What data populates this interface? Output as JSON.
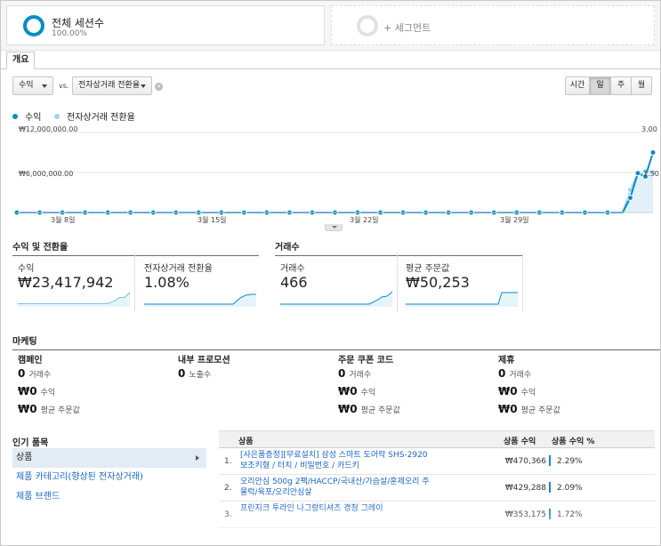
{
  "segments": {
    "active_title": "전체 세션수",
    "active_percent": "100.00%",
    "add_label": "+ 세그먼트"
  },
  "tab": {
    "label": "개요"
  },
  "controls": {
    "metric1": "수익",
    "vs": "vs.",
    "metric2": "전자상거래 전환율",
    "granularity": [
      "시간",
      "일",
      "주",
      "월"
    ],
    "active_granularity": "일"
  },
  "legend": [
    {
      "label": "수익",
      "color": "#058dc7"
    },
    {
      "label": "전자상거래 전환율",
      "color": "#9fd4ee"
    }
  ],
  "chart_data": {
    "type": "line",
    "y_left_ticks": [
      "₩12,000,000.00",
      "₩6,000,000.00"
    ],
    "y_right_ticks": [
      "3.00",
      "1.50"
    ],
    "x_tick_labels": [
      "3월 8일",
      "3월 15일",
      "3월 22일",
      "3월 29일"
    ],
    "ylim_left": [
      0,
      12000000
    ],
    "ylim_right": [
      0,
      3.0
    ],
    "series": [
      {
        "name": "수익",
        "values": [
          0,
          0,
          0,
          0,
          0,
          0,
          0,
          0,
          0,
          0,
          0,
          0,
          0,
          0,
          0,
          0,
          0,
          0,
          0,
          0,
          0,
          0,
          0,
          0,
          0,
          0,
          0,
          0,
          0,
          0,
          0,
          0,
          0,
          0,
          0,
          0,
          0,
          0,
          0,
          0,
          0,
          0,
          0,
          0,
          0,
          0,
          0,
          0,
          0,
          0,
          0,
          0,
          0,
          0,
          0,
          0,
          0,
          0,
          0,
          0,
          0,
          0,
          0,
          0,
          0,
          0,
          0,
          0,
          0,
          0,
          0,
          0,
          0,
          0,
          0,
          0,
          0,
          0,
          0,
          0,
          0,
          2200000,
          5900000,
          5400000,
          9000000
        ]
      },
      {
        "name": "전자상거래 전환율",
        "values": [
          0,
          0,
          0,
          0,
          0,
          0,
          0,
          0,
          0,
          0,
          0,
          0,
          0,
          0,
          0,
          0,
          0,
          0,
          0,
          0,
          0,
          0,
          0,
          0,
          0,
          0,
          0,
          0,
          0,
          0,
          0,
          0,
          0,
          0,
          0,
          0,
          0,
          0,
          0,
          0,
          0,
          0,
          0,
          0,
          0,
          0,
          0,
          0,
          0,
          0,
          0,
          0,
          0,
          0,
          0,
          0,
          0,
          0,
          0,
          0,
          0,
          0,
          0,
          0,
          0,
          0,
          0,
          0,
          0,
          0,
          0,
          0,
          0,
          0,
          0,
          0,
          0,
          0,
          0,
          0,
          0,
          0.85,
          1.45,
          1.55,
          1.5
        ]
      }
    ]
  },
  "sections": {
    "revenue_conversion": "수익 및 전환율",
    "transactions": "거래수",
    "marketing": "마케팅",
    "top_products": "인기 품목"
  },
  "metrics": [
    {
      "label": "수익",
      "value": "₩23,417,942"
    },
    {
      "label": "전자상거래 전환율",
      "value": "1.08%"
    },
    {
      "label": "거래수",
      "value": "466"
    },
    {
      "label": "평균 주문값",
      "value": "₩50,253"
    }
  ],
  "marketing": [
    {
      "title": "캠페인",
      "rows": [
        {
          "v": "0",
          "l": "거래수"
        },
        {
          "v": "₩0",
          "l": "수익"
        },
        {
          "v": "₩0",
          "l": "평균 주문값"
        }
      ]
    },
    {
      "title": "내부 프로모션",
      "rows": [
        {
          "v": "0",
          "l": "노출수"
        }
      ]
    },
    {
      "title": "주문 쿠폰 코드",
      "rows": [
        {
          "v": "0",
          "l": "거래수"
        },
        {
          "v": "₩0",
          "l": "수익"
        },
        {
          "v": "₩0",
          "l": "평균 주문값"
        }
      ]
    },
    {
      "title": "제휴",
      "rows": [
        {
          "v": "0",
          "l": "거래수"
        },
        {
          "v": "₩0",
          "l": "수익"
        },
        {
          "v": "₩0",
          "l": "평균 주문값"
        }
      ]
    }
  ],
  "top_nav": [
    "상품",
    "제품 카테고리(향상된 전자상거래)",
    "제품 브랜드"
  ],
  "product_table": {
    "headers": [
      "상품",
      "상품 수익",
      "상품 수익 %"
    ],
    "rows": [
      {
        "idx": "1.",
        "name": "[사은품증정][무료설치] 삼성 스마트 도어락 SHS-2920 보조키형 / 터치 / 비밀번호 / 카드키",
        "revenue": "₩470,366",
        "pct": "2.29%"
      },
      {
        "idx": "2.",
        "name": "오리안심 500g 2팩/HACCP/국내산/가슴살/훈제오리 주물럭/육포/오리안심살",
        "revenue": "₩429,288",
        "pct": "2.09%"
      },
      {
        "idx": "3.",
        "name": "프린지크 투라인 나그랑티셔츠 경청 그레이",
        "revenue": "₩353,175",
        "pct": "1.72%"
      }
    ]
  }
}
